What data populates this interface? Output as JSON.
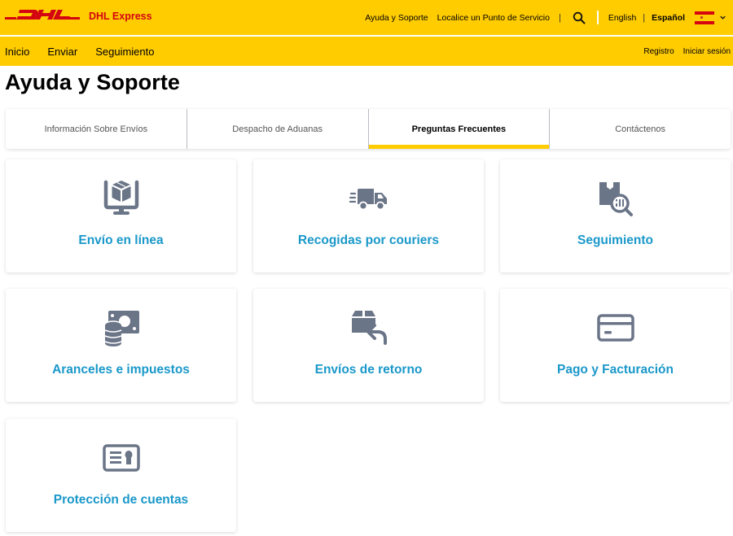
{
  "header": {
    "logo_text": "DHL",
    "brand": "DHL Express",
    "links": [
      "Ayuda y Soporte",
      "Localice un Punto de Servicio"
    ],
    "search_icon": "search-icon",
    "languages": [
      {
        "label": "English",
        "selected": false
      },
      {
        "label": "Español",
        "selected": true
      }
    ],
    "country_flag": "spain-flag-icon"
  },
  "nav": {
    "main": [
      "Inicio",
      "Enviar",
      "Seguimiento"
    ],
    "right": [
      "Registro",
      "Iniciar sesión"
    ]
  },
  "page": {
    "title": "Ayuda y Soporte"
  },
  "tabs": [
    {
      "label": "Información Sobre Envíos",
      "active": false
    },
    {
      "label": "Despacho de Aduanas",
      "active": false
    },
    {
      "label": "Preguntas Frecuentes",
      "active": true
    },
    {
      "label": "Contáctenos",
      "active": false
    }
  ],
  "cards": [
    {
      "label": "Envío en línea",
      "icon": "monitor-package-icon"
    },
    {
      "label": "Recogidas por couriers",
      "icon": "delivery-truck-icon"
    },
    {
      "label": "Seguimiento",
      "icon": "package-search-icon"
    },
    {
      "label": "Aranceles e impuestos",
      "icon": "money-coins-icon"
    },
    {
      "label": "Envíos de retorno",
      "icon": "package-return-icon"
    },
    {
      "label": "Pago y Facturación",
      "icon": "credit-card-icon"
    },
    {
      "label": "Protección de cuentas",
      "icon": "id-card-icon"
    }
  ],
  "colors": {
    "brand_yellow": "#ffcc00",
    "brand_red": "#d40511",
    "link_blue": "#1a98c9",
    "icon_gray": "#6b7588"
  }
}
